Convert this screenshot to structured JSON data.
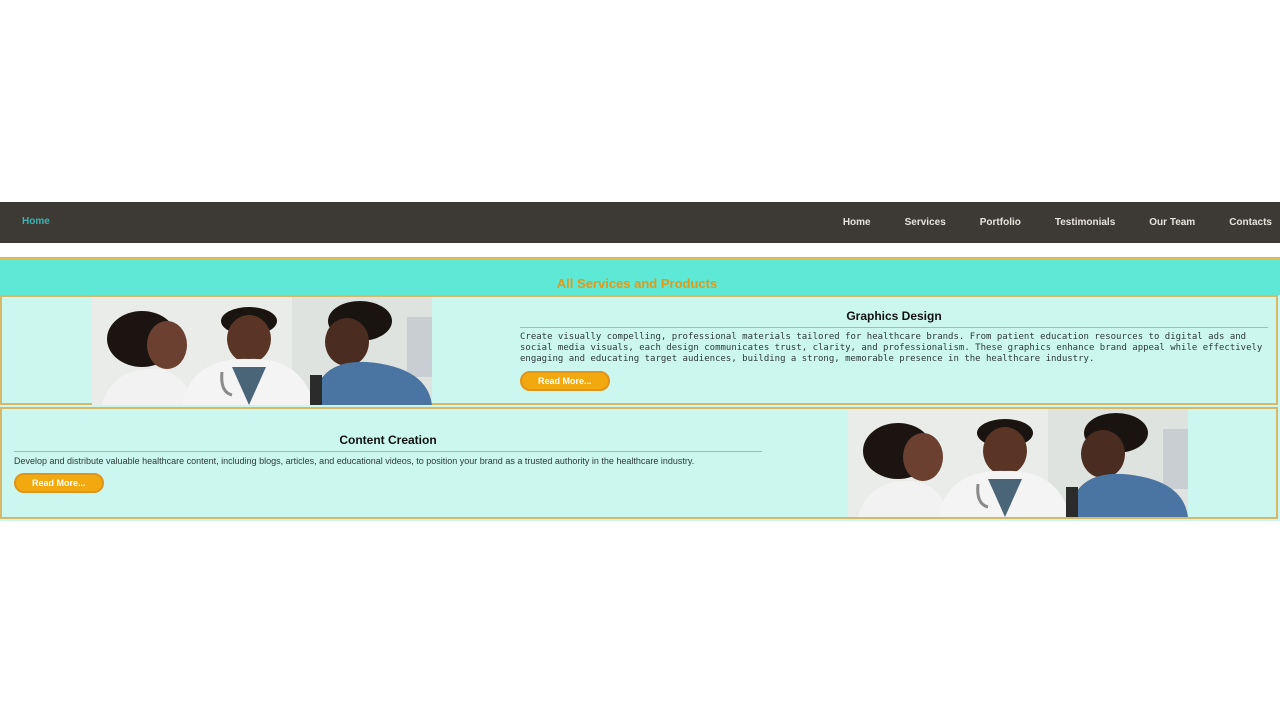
{
  "nav": {
    "brand": "Home",
    "links": [
      "Home",
      "Services",
      "Portfolio",
      "Testimonials",
      "Our Team",
      "Contacts"
    ]
  },
  "services": {
    "title": "All Services and Products",
    "cards": [
      {
        "title": "Graphics Design",
        "description": "Create visually compelling, professional materials tailored for healthcare brands. From patient education resources to digital ads and social media visuals, each design communicates trust, clarity, and professionalism. These graphics enhance brand appeal while effectively engaging and educating target audiences, building a strong, memorable presence in the healthcare industry.",
        "button": "Read More..."
      },
      {
        "title": "Content Creation",
        "description": "Develop and distribute valuable healthcare content, including blogs, articles, and educational videos, to position your brand as a trusted authority in the healthcare industry.",
        "button": "Read More..."
      }
    ]
  },
  "colors": {
    "navbar": "#3d3a35",
    "header": "#5ee8d6",
    "card_bg": "#ccf7ee",
    "button": "#f2a90f",
    "accent_title": "#e09a1a"
  }
}
